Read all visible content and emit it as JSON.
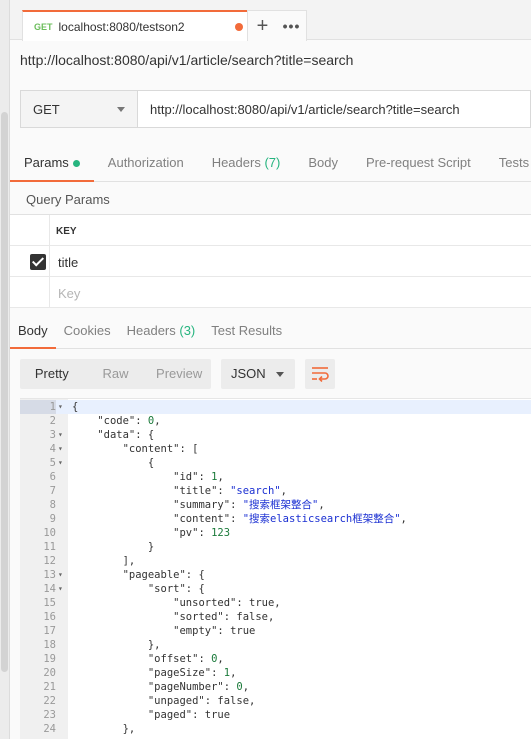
{
  "tab": {
    "method": "GET",
    "title": "localhost:8080/testson2",
    "add_icon": "plus-icon",
    "more_icon": "ellipsis-icon"
  },
  "request": {
    "title_url": "http://localhost:8080/api/v1/article/search?title=search",
    "method": "GET",
    "url": "http://localhost:8080/api/v1/article/search?title=search"
  },
  "request_tabs": [
    {
      "label": "Params"
    },
    {
      "label": "Authorization"
    },
    {
      "label": "Headers",
      "count": "(7)"
    },
    {
      "label": "Body"
    },
    {
      "label": "Pre-request Script"
    },
    {
      "label": "Tests"
    }
  ],
  "query_params": {
    "title": "Query Params",
    "key_header": "KEY",
    "rows": [
      {
        "key": "title",
        "checked": true
      }
    ],
    "key_placeholder": "Key"
  },
  "response_tabs": [
    {
      "label": "Body"
    },
    {
      "label": "Cookies"
    },
    {
      "label": "Headers",
      "count": "(3)"
    },
    {
      "label": "Test Results"
    }
  ],
  "view": {
    "modes": [
      "Pretty",
      "Raw",
      "Preview"
    ],
    "active_mode": "Pretty",
    "format": "JSON",
    "wrap_icon": "wrap-lines-icon"
  },
  "colors": {
    "accent": "#f26b3a",
    "success": "#26b47f",
    "string": "#1a2fd2",
    "number": "#1a7a3a"
  },
  "response_lines": [
    {
      "n": "1",
      "fold": true,
      "tokens": [
        [
          "p",
          "{"
        ]
      ]
    },
    {
      "n": "2",
      "fold": false,
      "tokens": [
        [
          "p",
          "    "
        ],
        [
          "k",
          "\"code\""
        ],
        [
          "p",
          ": "
        ],
        [
          "n",
          "0"
        ],
        [
          "p",
          ","
        ]
      ]
    },
    {
      "n": "3",
      "fold": true,
      "tokens": [
        [
          "p",
          "    "
        ],
        [
          "k",
          "\"data\""
        ],
        [
          "p",
          ": {"
        ]
      ]
    },
    {
      "n": "4",
      "fold": true,
      "tokens": [
        [
          "p",
          "        "
        ],
        [
          "k",
          "\"content\""
        ],
        [
          "p",
          ": ["
        ]
      ]
    },
    {
      "n": "5",
      "fold": true,
      "tokens": [
        [
          "p",
          "            {"
        ]
      ]
    },
    {
      "n": "6",
      "fold": false,
      "tokens": [
        [
          "p",
          "                "
        ],
        [
          "k",
          "\"id\""
        ],
        [
          "p",
          ": "
        ],
        [
          "n",
          "1"
        ],
        [
          "p",
          ","
        ]
      ]
    },
    {
      "n": "7",
      "fold": false,
      "tokens": [
        [
          "p",
          "                "
        ],
        [
          "k",
          "\"title\""
        ],
        [
          "p",
          ": "
        ],
        [
          "s",
          "\"search\""
        ],
        [
          "p",
          ","
        ]
      ]
    },
    {
      "n": "8",
      "fold": false,
      "tokens": [
        [
          "p",
          "                "
        ],
        [
          "k",
          "\"summary\""
        ],
        [
          "p",
          ": "
        ],
        [
          "s",
          "\"搜索框架整合\""
        ],
        [
          "p",
          ","
        ]
      ]
    },
    {
      "n": "9",
      "fold": false,
      "tokens": [
        [
          "p",
          "                "
        ],
        [
          "k",
          "\"content\""
        ],
        [
          "p",
          ": "
        ],
        [
          "s",
          "\"搜索elasticsearch框架整合\""
        ],
        [
          "p",
          ","
        ]
      ]
    },
    {
      "n": "10",
      "fold": false,
      "tokens": [
        [
          "p",
          "                "
        ],
        [
          "k",
          "\"pv\""
        ],
        [
          "p",
          ": "
        ],
        [
          "n",
          "123"
        ]
      ]
    },
    {
      "n": "11",
      "fold": false,
      "tokens": [
        [
          "p",
          "            }"
        ]
      ]
    },
    {
      "n": "12",
      "fold": false,
      "tokens": [
        [
          "p",
          "        ],"
        ]
      ]
    },
    {
      "n": "13",
      "fold": true,
      "tokens": [
        [
          "p",
          "        "
        ],
        [
          "k",
          "\"pageable\""
        ],
        [
          "p",
          ": {"
        ]
      ]
    },
    {
      "n": "14",
      "fold": true,
      "tokens": [
        [
          "p",
          "            "
        ],
        [
          "k",
          "\"sort\""
        ],
        [
          "p",
          ": {"
        ]
      ]
    },
    {
      "n": "15",
      "fold": false,
      "tokens": [
        [
          "p",
          "                "
        ],
        [
          "k",
          "\"unsorted\""
        ],
        [
          "p",
          ": true,"
        ]
      ]
    },
    {
      "n": "16",
      "fold": false,
      "tokens": [
        [
          "p",
          "                "
        ],
        [
          "k",
          "\"sorted\""
        ],
        [
          "p",
          ": false,"
        ]
      ]
    },
    {
      "n": "17",
      "fold": false,
      "tokens": [
        [
          "p",
          "                "
        ],
        [
          "k",
          "\"empty\""
        ],
        [
          "p",
          ": true"
        ]
      ]
    },
    {
      "n": "18",
      "fold": false,
      "tokens": [
        [
          "p",
          "            },"
        ]
      ]
    },
    {
      "n": "19",
      "fold": false,
      "tokens": [
        [
          "p",
          "            "
        ],
        [
          "k",
          "\"offset\""
        ],
        [
          "p",
          ": "
        ],
        [
          "n",
          "0"
        ],
        [
          "p",
          ","
        ]
      ]
    },
    {
      "n": "20",
      "fold": false,
      "tokens": [
        [
          "p",
          "            "
        ],
        [
          "k",
          "\"pageSize\""
        ],
        [
          "p",
          ": "
        ],
        [
          "n",
          "1"
        ],
        [
          "p",
          ","
        ]
      ]
    },
    {
      "n": "21",
      "fold": false,
      "tokens": [
        [
          "p",
          "            "
        ],
        [
          "k",
          "\"pageNumber\""
        ],
        [
          "p",
          ": "
        ],
        [
          "n",
          "0"
        ],
        [
          "p",
          ","
        ]
      ]
    },
    {
      "n": "22",
      "fold": false,
      "tokens": [
        [
          "p",
          "            "
        ],
        [
          "k",
          "\"unpaged\""
        ],
        [
          "p",
          ": false,"
        ]
      ]
    },
    {
      "n": "23",
      "fold": false,
      "tokens": [
        [
          "p",
          "            "
        ],
        [
          "k",
          "\"paged\""
        ],
        [
          "p",
          ": true"
        ]
      ]
    },
    {
      "n": "24",
      "fold": false,
      "tokens": [
        [
          "p",
          "        },"
        ]
      ]
    }
  ]
}
